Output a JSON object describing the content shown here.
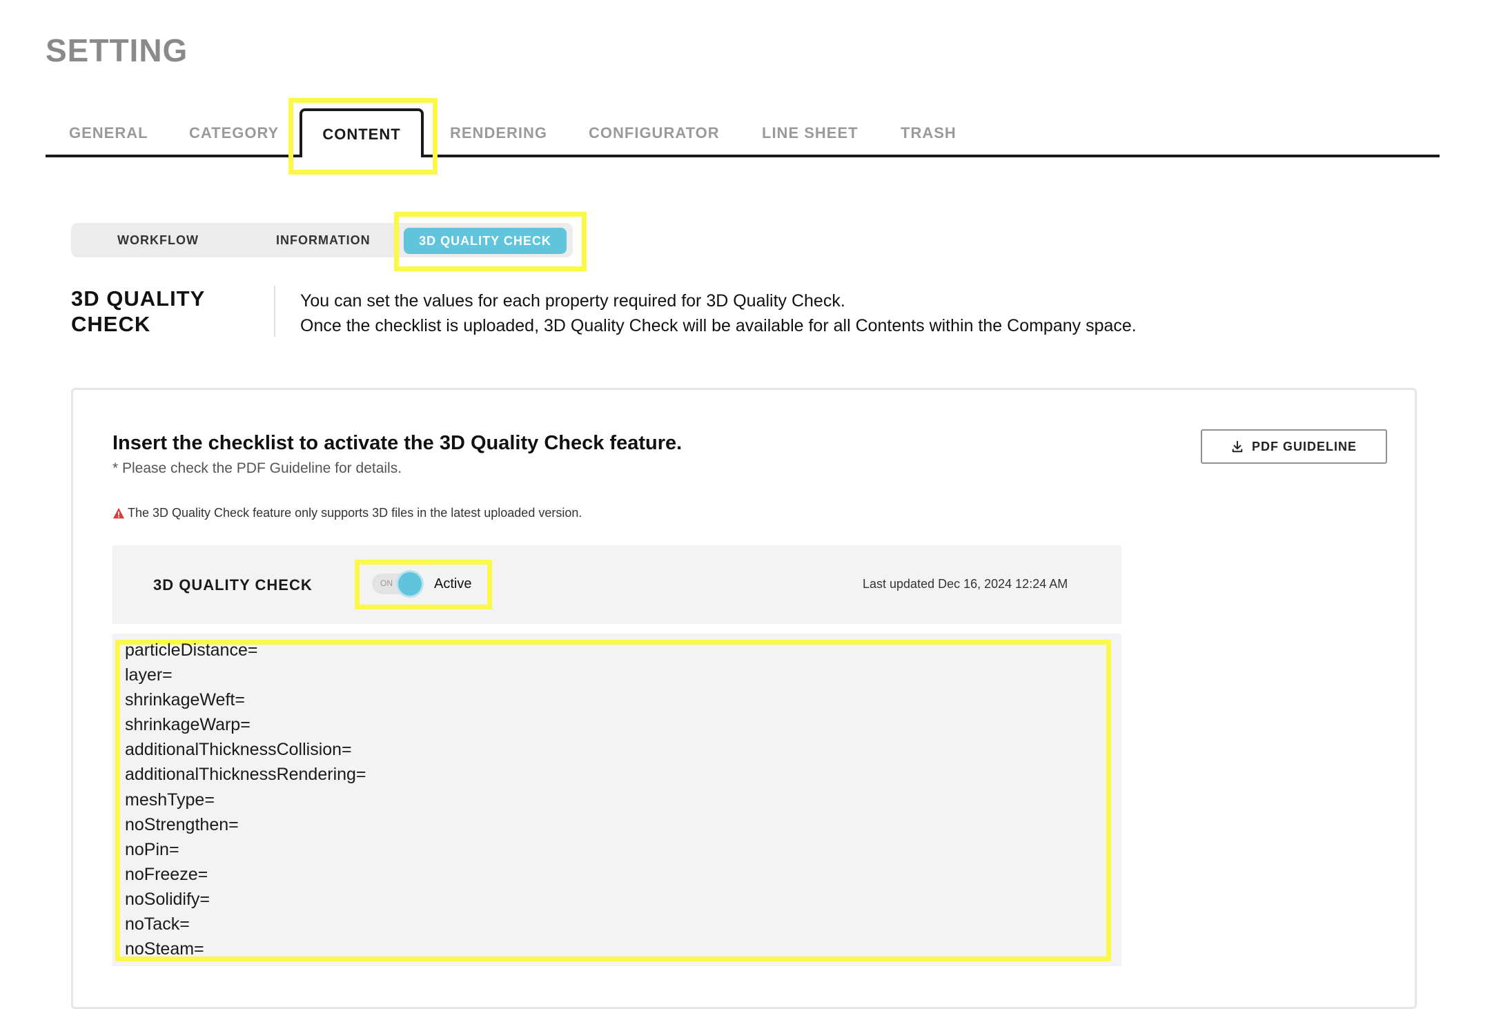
{
  "page": {
    "title": "SETTING"
  },
  "tabs": [
    {
      "label": "GENERAL"
    },
    {
      "label": "CATEGORY"
    },
    {
      "label": "CONTENT"
    },
    {
      "label": "RENDERING"
    },
    {
      "label": "CONFIGURATOR"
    },
    {
      "label": "LINE SHEET"
    },
    {
      "label": "TRASH"
    }
  ],
  "active_tab": "CONTENT",
  "subtabs": [
    {
      "label": "WORKFLOW"
    },
    {
      "label": "INFORMATION"
    },
    {
      "label": "3D QUALITY CHECK"
    }
  ],
  "active_subtab": "3D QUALITY CHECK",
  "section": {
    "title_line1": "3D QUALITY",
    "title_line2": "CHECK",
    "desc_line1": "You can set the values for each property required for 3D Quality Check.",
    "desc_line2": "Once the checklist is uploaded, 3D Quality Check will be available for all Contents within the Company space."
  },
  "card": {
    "heading": "Insert the checklist to activate the 3D Quality Check feature.",
    "note": "* Please check the PDF Guideline for details.",
    "warning": "The 3D Quality Check feature only supports 3D files in the latest uploaded version.",
    "pdf_button": "PDF GUIDELINE"
  },
  "quality_check": {
    "label": "3D QUALITY CHECK",
    "toggle_on_text": "ON",
    "toggle_enabled": true,
    "status": "Active",
    "last_updated": "Last updated Dec 16, 2024 12:24 AM"
  },
  "checklist": [
    "particleDistance=",
    "layer=",
    "shrinkageWeft=",
    "shrinkageWarp=",
    "additionalThicknessCollision=",
    "additionalThicknessRendering=",
    "meshType=",
    "noStrengthen=",
    "noPin=",
    "noFreeze=",
    "noSolidify=",
    "noTack=",
    "noSteam="
  ],
  "colors": {
    "accent": "#5fc4dc",
    "highlight": "#fbf84a",
    "warning": "#e03a3a",
    "panel": "#f3f3f4"
  }
}
